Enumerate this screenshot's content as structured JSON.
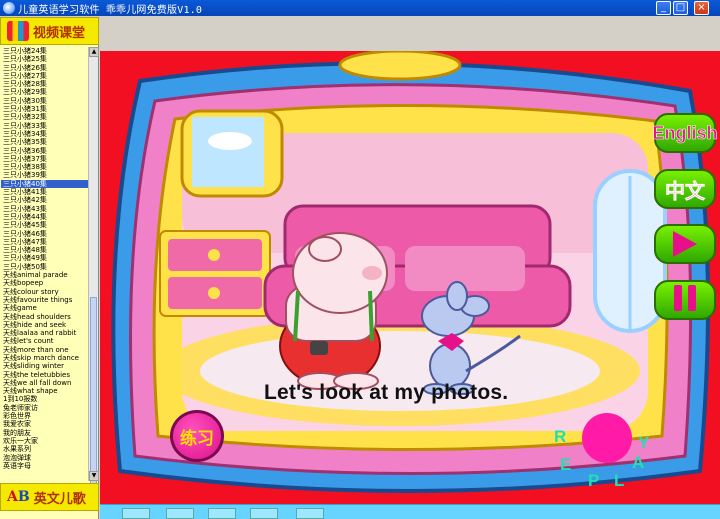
{
  "window": {
    "title": "儿童英语学习软件  乖乖儿网免费版V1.0",
    "controls": {
      "minimize": "_",
      "maximize": "□",
      "close": "×"
    }
  },
  "sidebar": {
    "video_header": "视频课堂",
    "english_header": "英文儿歌",
    "ab_icon_a": "A",
    "ab_icon_b": "B",
    "selected_index": 16,
    "items": [
      "三只小猪24集",
      "三只小猪25集",
      "三只小猪26集",
      "三只小猪27集",
      "三只小猪28集",
      "三只小猪29集",
      "三只小猪30集",
      "三只小猪31集",
      "三只小猪32集",
      "三只小猪33集",
      "三只小猪34集",
      "三只小猪35集",
      "三只小猪36集",
      "三只小猪37集",
      "三只小猪38集",
      "三只小猪39集",
      "三只小猪40集",
      "三只小猪41集",
      "三只小猪42集",
      "三只小猪43集",
      "三只小猪44集",
      "三只小猪45集",
      "三只小猪46集",
      "三只小猪47集",
      "三只小猪48集",
      "三只小猪49集",
      "三只小猪50集",
      "天线animal parade",
      "天线bopeep",
      "天线colour story",
      "天线favourite things",
      "天线game",
      "天线head shoulders",
      "天线hide and seek",
      "天线laalaa and rabbit",
      "天线let's count",
      "天线more than one",
      "天线skip march dance",
      "天线sliding winter",
      "天线the teletubbies",
      "天线we all fall down",
      "天线what shape",
      "1到10报数",
      "兔老师家访",
      "彩色世界",
      "我爱农家",
      "我的朋友",
      "欢乐一大家",
      "水果系列",
      "泡泡弹球",
      "英语字母"
    ]
  },
  "stage": {
    "caption": "Let's look at my photos.",
    "buttons": {
      "english": "English",
      "chinese": "中文",
      "practice": "练习"
    },
    "replay_letters": [
      "R",
      "E",
      "P",
      "L",
      "A",
      "Y"
    ],
    "colors": {
      "background": "#f20f22",
      "accent_pink": "#e8108a",
      "button_green": "#4cc800"
    }
  }
}
